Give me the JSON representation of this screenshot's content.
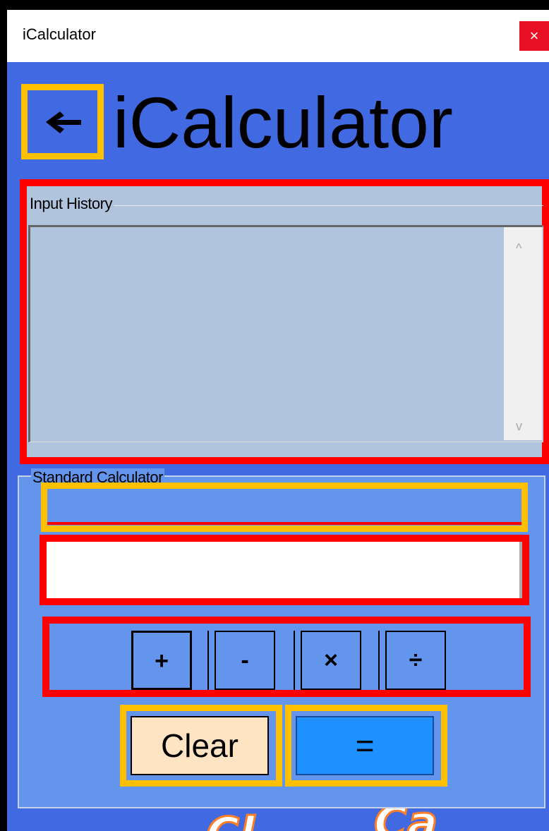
{
  "window": {
    "title": "iCalculator",
    "close_label": "×"
  },
  "header": {
    "back_icon": "left-arrow-icon",
    "app_title": "iCalculator"
  },
  "history": {
    "group_label": "Input History",
    "content": "",
    "scroll_up": "^",
    "scroll_down": "v"
  },
  "calculator": {
    "group_label": "Standard Calculator",
    "expression": "",
    "input_value": "",
    "operators": {
      "plus": "+",
      "minus": "-",
      "times": "×",
      "divide": "÷"
    },
    "clear_label": "Clear",
    "equals_label": "="
  },
  "footer": {
    "deco_text_1": "Cl",
    "deco_text_2": "Ca"
  },
  "colors": {
    "window_bg": "#4169e1",
    "history_bg": "#b0c4de",
    "calc_bg": "#6495ed",
    "clear_bg": "#ffe4c4",
    "equals_bg": "#1e90ff",
    "highlight_yellow": "#ffc000",
    "highlight_red": "#ff0000"
  }
}
